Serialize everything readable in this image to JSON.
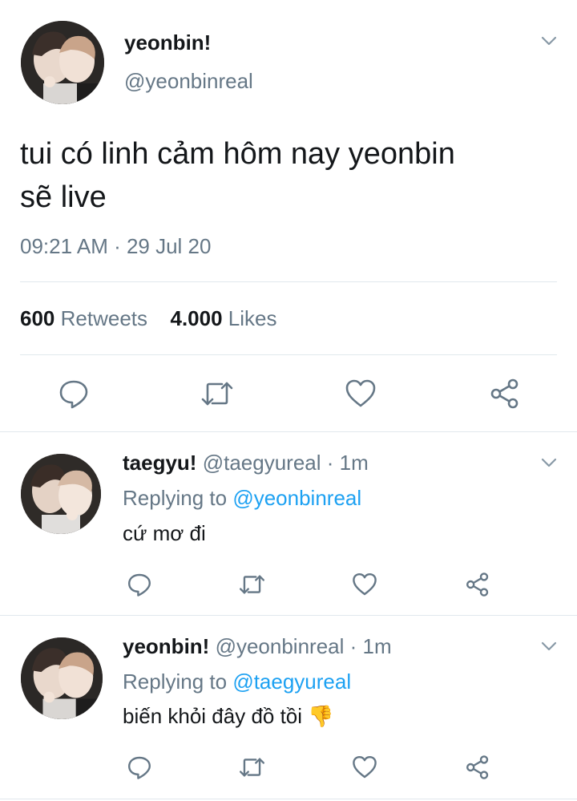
{
  "main_tweet": {
    "display_name": "yeonbin!",
    "handle": "@yeonbinreal",
    "text_line1": "tui có linh cảm hôm nay yeonbin",
    "text_line2": "sẽ live",
    "timestamp": "09:21 AM · 29 Jul 20",
    "retweets_count": "600",
    "retweets_label": "Retweets",
    "likes_count": "4.000",
    "likes_label": "Likes"
  },
  "replies": [
    {
      "display_name": "taegyu!",
      "handle": "@taegyureal",
      "age": "· 1m",
      "replying_label": "Replying to",
      "replying_to": "@yeonbinreal",
      "text": "cứ mơ đi"
    },
    {
      "display_name": "yeonbin!",
      "handle": "@yeonbinreal",
      "age": "· 1m",
      "replying_label": "Replying to",
      "replying_to": "@taegyureal",
      "text": "biến khỏi đây đồ tồi 👎"
    }
  ],
  "icons": {
    "reply": "reply-icon",
    "retweet": "retweet-icon",
    "like": "heart-icon",
    "share": "share-icon",
    "menu": "chevron-down-icon",
    "emoji": "thumbs-down-emoji"
  },
  "colors": {
    "text": "#14171a",
    "secondary": "#657786",
    "link": "#1da1f2",
    "divider": "#e1e8ed"
  }
}
